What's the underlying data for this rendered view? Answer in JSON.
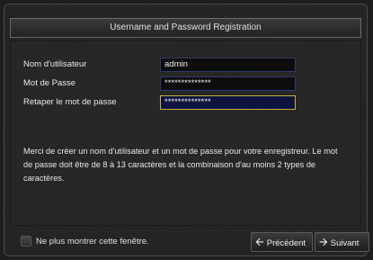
{
  "dialog": {
    "title": "Username and Password Registration"
  },
  "form": {
    "username_label": "Nom d'utilisateur",
    "username_value": "admin",
    "password_label": "Mot de Passe",
    "password_value": "**************",
    "confirm_label": "Retaper le mot de passe",
    "confirm_value": "**************"
  },
  "info": {
    "message": "Merci de créer un nom d'utilisateur et un mot de passe pour votre enregistreur. Le mot de passe doit être de 8 à 13 caractères et la combinaison d'au moins 2 types de caractères."
  },
  "footer": {
    "checkbox_label": "Ne plus montrer cette fenêtre.",
    "prev_label": "Précédent",
    "next_label": "Suivant",
    "prev_icon": "arrow-left-icon",
    "next_icon": "arrow-right-icon"
  }
}
